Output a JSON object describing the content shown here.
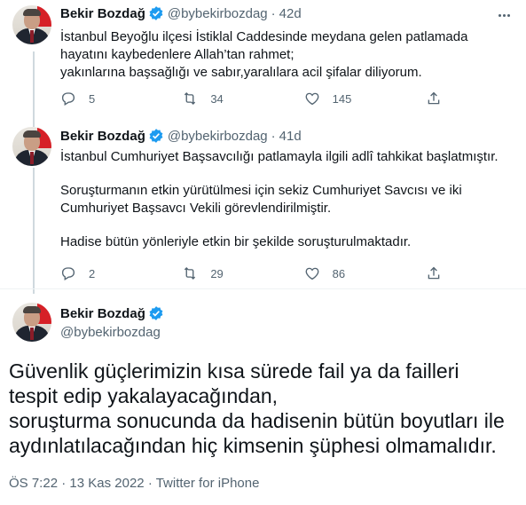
{
  "author": {
    "name": "Bekir Bozdağ",
    "handle": "@bybekirbozdag"
  },
  "tweets": [
    {
      "time": "42d",
      "lines": [
        "İstanbul Beyoğlu ilçesi İstiklal Caddesinde meydana gelen patlamada",
        "hayatını kaybedenlere Allah’tan rahmet;",
        "yakınlarına başsağlığı ve sabır,yaralılara acil şifalar diliyorum."
      ],
      "replies": "5",
      "retweets": "34",
      "likes": "145"
    },
    {
      "time": "41d",
      "paragraphs": [
        "İstanbul Cumhuriyet Başsavcılığı patlamayla ilgili adlî tahkikat başlatmıştır.",
        "Soruşturmanın etkin yürütülmesi için sekiz Cumhuriyet Savcısı ve iki Cumhuriyet Başsavcı Vekili görevlendirilmiştir.",
        "Hadise bütün yönleriyle etkin bir şekilde soruşturulmaktadır."
      ],
      "replies": "2",
      "retweets": "29",
      "likes": "86"
    }
  ],
  "main_tweet": {
    "lines": [
      "Güvenlik güçlerimizin kısa sürede fail ya da failleri",
      "tespit edip yakalayacağından,",
      "soruşturma sonucunda da hadisenin bütün boyutları ile",
      "aydınlatılacağından hiç kimsenin şüphesi olmamalıdır."
    ],
    "time": "ÖS 7:22",
    "date": "13 Kas 2022",
    "dot": "·",
    "source": "Twitter for iPhone"
  },
  "icons": {
    "verified": "verified-badge-icon",
    "reply": "reply-icon",
    "retweet": "retweet-icon",
    "like": "heart-icon",
    "share": "share-icon",
    "more": "more-icon"
  },
  "colors": {
    "verified": "#1d9bf0",
    "secondary_text": "#536471",
    "thread_line": "#cfd9de"
  }
}
